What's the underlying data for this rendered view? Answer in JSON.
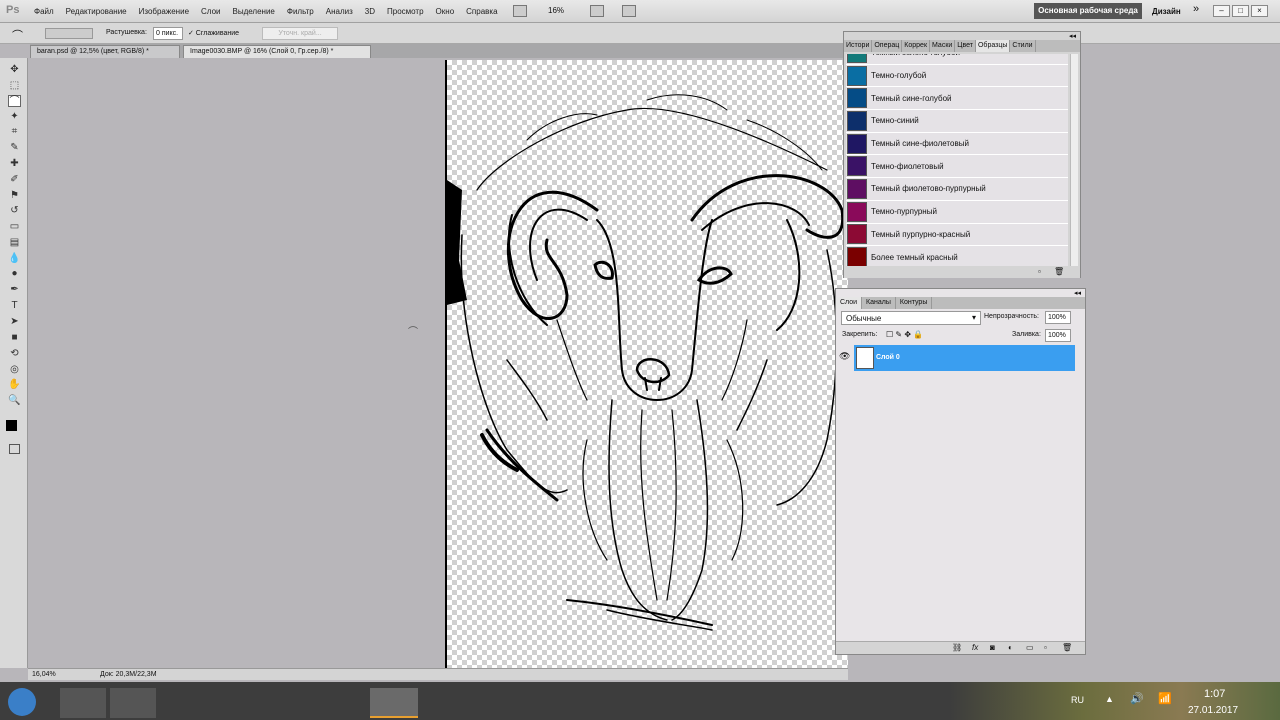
{
  "app_logo": "Ps",
  "menu": [
    "Файл",
    "Редактирование",
    "Изображение",
    "Слои",
    "Выделение",
    "Фильтр",
    "Анализ",
    "3D",
    "Просмотр",
    "Окно",
    "Справка"
  ],
  "zoom_select": "16%",
  "workspace": {
    "active": "Основная рабочая среда",
    "design": "Дизайн",
    "more": "»"
  },
  "window_controls": [
    "–",
    "□",
    "×"
  ],
  "options": {
    "feather_label": "Растушевка:",
    "feather_value": "0 пикс.",
    "antialias_label": "✓ Сглаживание",
    "refine_label": "Уточн. край..."
  },
  "tabs": [
    "baran.psd @ 12,5% (цвет, RGB/8) *",
    "Image0030.BMP @ 16% (Слой 0, Гр.сер./8) *"
  ],
  "status": {
    "zoom": "16,04%",
    "doc": "Док: 20,3M/22,3M"
  },
  "swatches": {
    "tabs": [
      "Истори",
      "Операц",
      "Коррек",
      "Маски",
      "Цвет",
      "Образцы",
      "Стили"
    ],
    "items": [
      {
        "name": "Темный зелено-голубой",
        "color": "#137a7a"
      },
      {
        "name": "Темно-голубой",
        "color": "#0a6ea3"
      },
      {
        "name": "Темный сине-голубой",
        "color": "#054c86"
      },
      {
        "name": "Темно-синий",
        "color": "#0d2f6b"
      },
      {
        "name": "Темный сине-фиолетовый",
        "color": "#1f1763"
      },
      {
        "name": "Темно-фиолетовый",
        "color": "#3a1266"
      },
      {
        "name": "Темный фиолетово-пурпурный",
        "color": "#5e0e62"
      },
      {
        "name": "Темно-пурпурный",
        "color": "#8a0a5a"
      },
      {
        "name": "Темный пурпурно-красный",
        "color": "#8c0a34"
      },
      {
        "name": "Более темный красный",
        "color": "#7a0000"
      }
    ]
  },
  "layers": {
    "tabs": [
      "Слои",
      "Каналы",
      "Контуры"
    ],
    "blend_mode": "Обычные",
    "opacity_label": "Непрозрачность:",
    "opacity": "100%",
    "lock_label": "Закрепить:",
    "fill_label": "Заливка:",
    "fill": "100%",
    "layer_name": "Слой 0"
  },
  "taskbar": {
    "lang": "RU",
    "time": "1:07",
    "date": "27.01.2017"
  }
}
